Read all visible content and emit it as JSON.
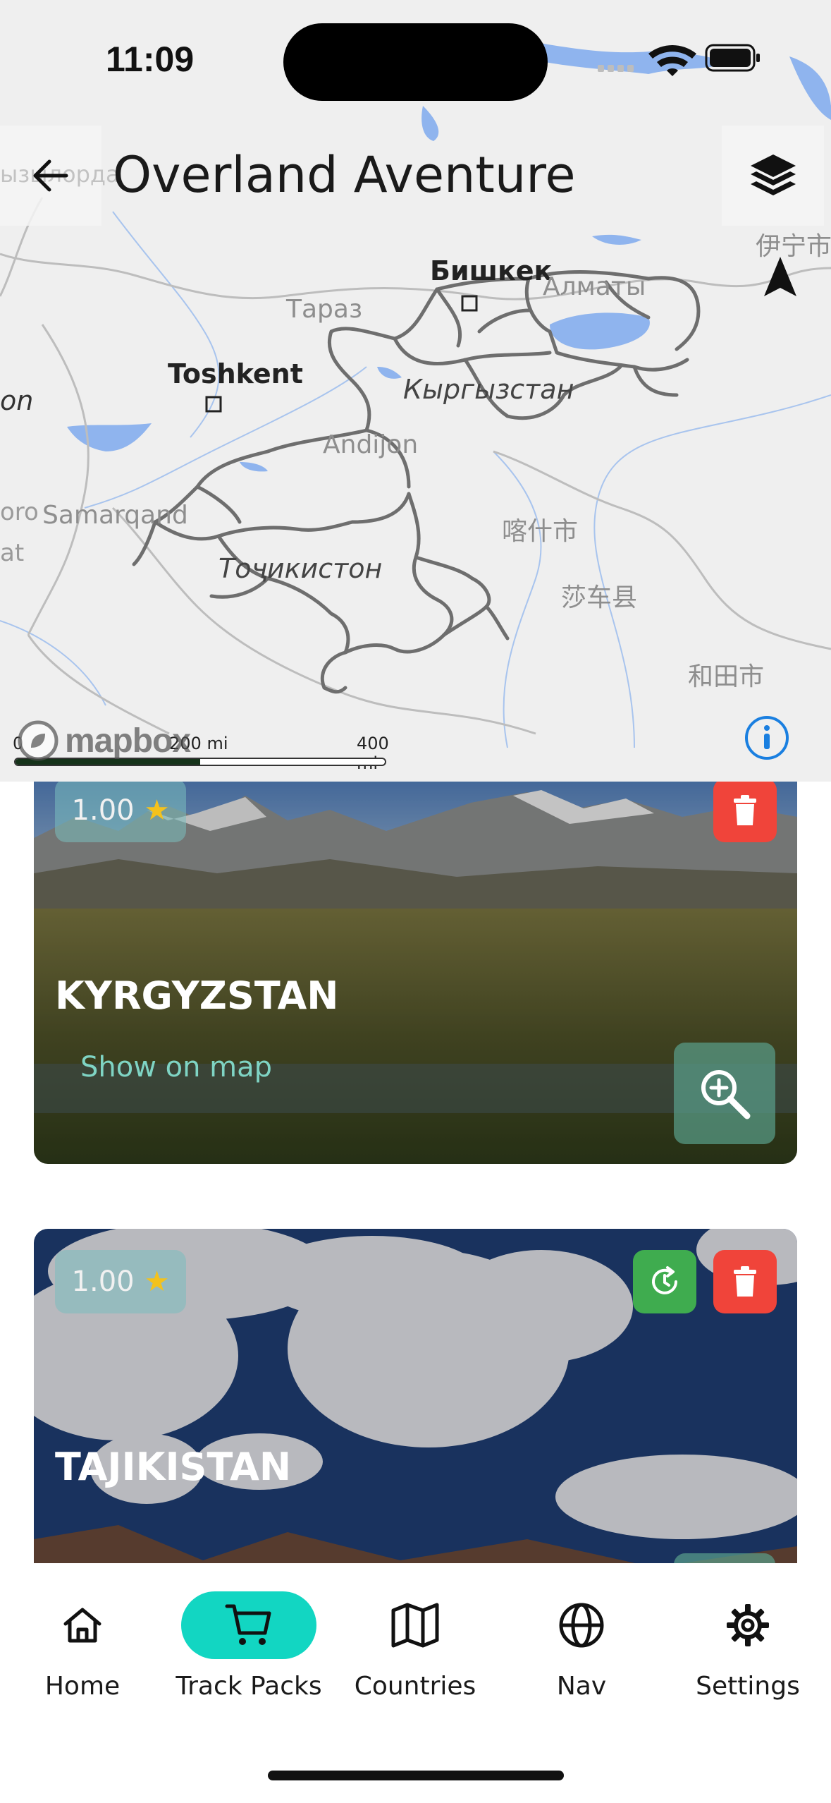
{
  "status_bar": {
    "time": "11:09"
  },
  "header": {
    "title": "Overland Aventure"
  },
  "map": {
    "labels": {
      "bishkek": "Бишкек",
      "almaty": "Алматы",
      "taraz": "Тараз",
      "toshkent": "Toshkent",
      "kyrgyzstan": "Кыргызстан",
      "andijon": "Andijon",
      "samarqand": "Samarqand",
      "tojikiston": "Тоҷикистон",
      "kashgar": "喀什市",
      "shache": "莎车县",
      "hotan": "和田市",
      "yining": "伊宁市",
      "edge_on": "on",
      "edge_oro": "oro",
      "edge_at": "at",
      "edge_kz": "ызылорда"
    },
    "attribution": "mapbox",
    "scale": {
      "zero": "0",
      "mid": "200 mi",
      "max": "400 mi"
    }
  },
  "cards": [
    {
      "rating": "1.00",
      "star": "★",
      "title": "KYRGYZSTAN",
      "show_on_map": "Show on map"
    },
    {
      "rating": "1.00",
      "star": "★",
      "title": "TAJIKISTAN"
    }
  ],
  "nav": {
    "items": [
      {
        "label": "Home",
        "icon": "home-icon"
      },
      {
        "label": "Track Packs",
        "icon": "cart-icon",
        "active": true
      },
      {
        "label": "Countries",
        "icon": "map-icon"
      },
      {
        "label": "Nav",
        "icon": "globe-icon"
      },
      {
        "label": "Settings",
        "icon": "gear-icon"
      }
    ]
  },
  "colors": {
    "accent": "#12d6c2",
    "delete": "#f0443a",
    "update": "#3fac4f",
    "water": "#8fb4ee",
    "track": "#6e6e6e"
  }
}
